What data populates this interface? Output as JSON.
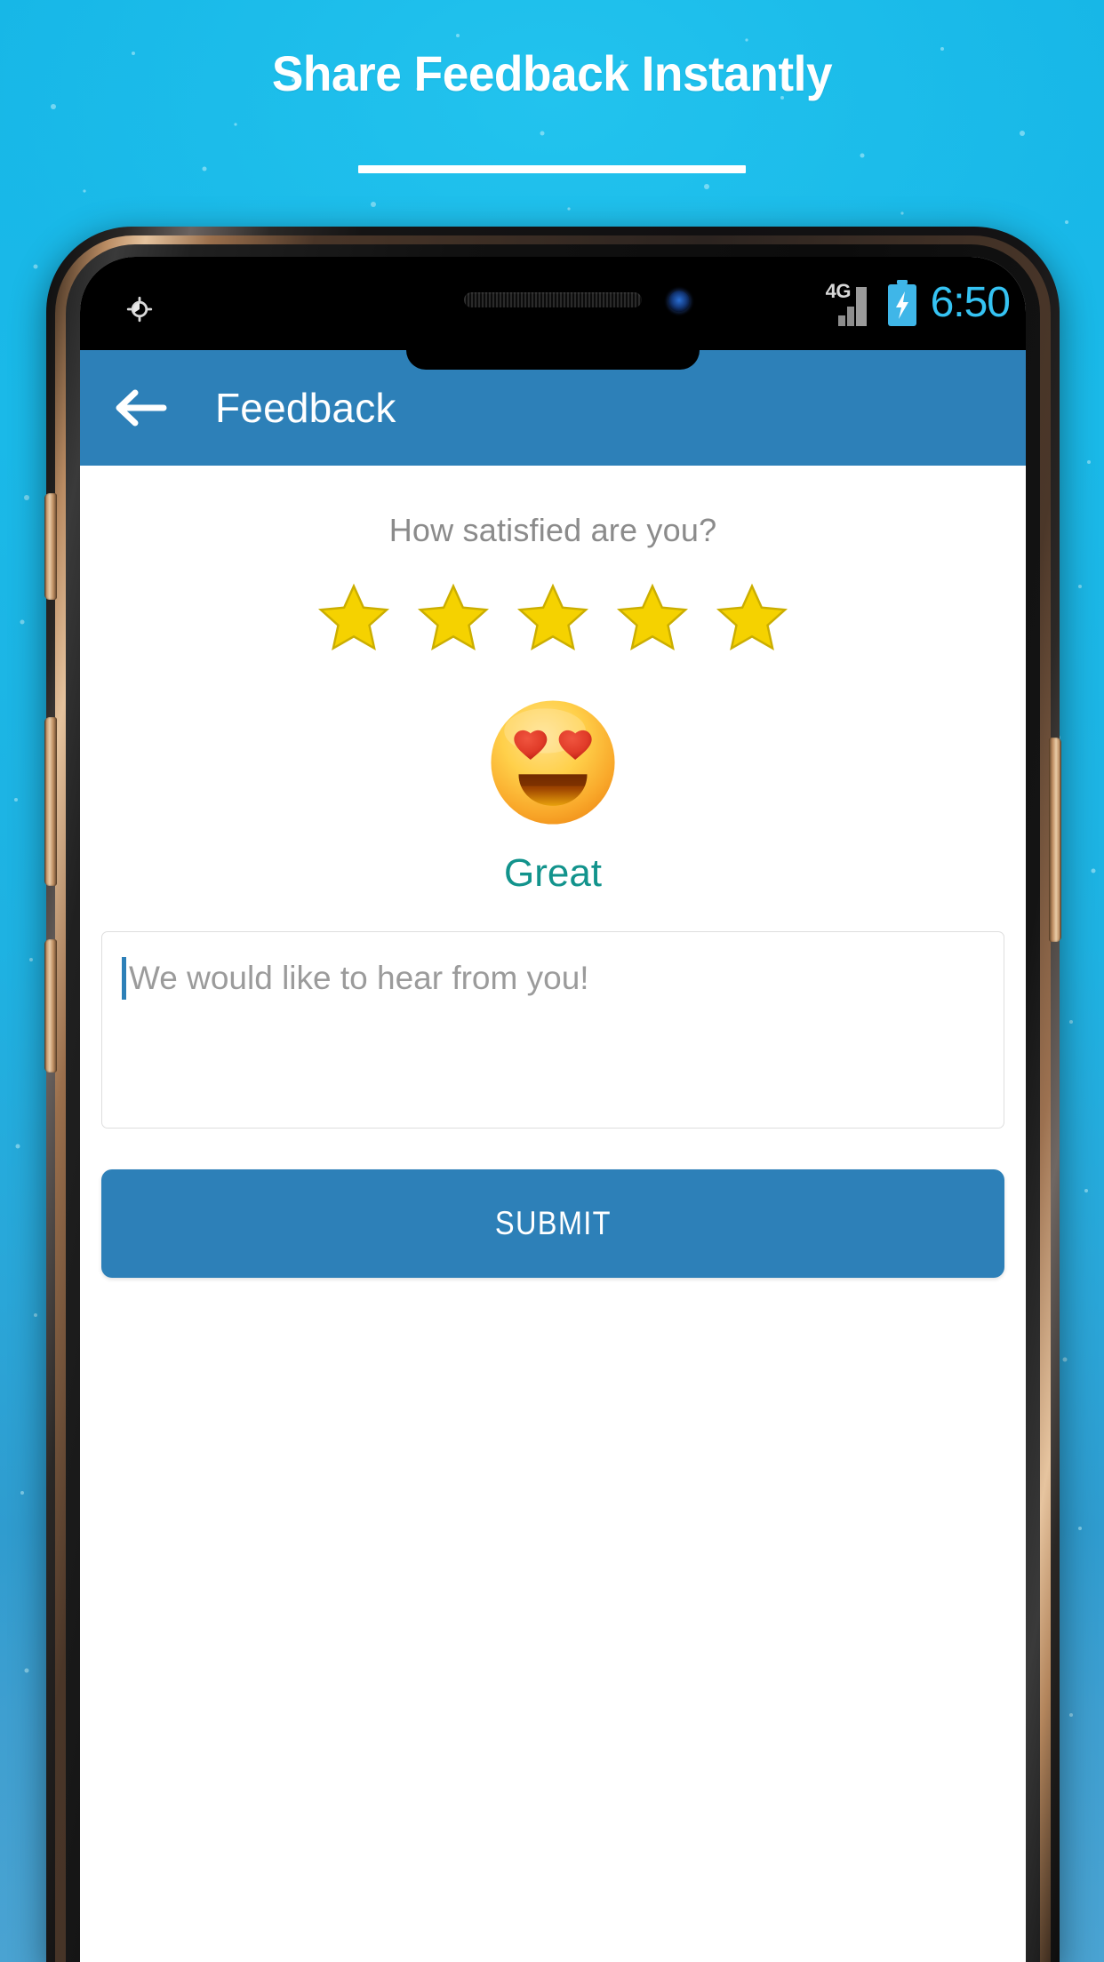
{
  "promo": {
    "headline": "Share Feedback Instantly",
    "accent_color": "#18b9e8",
    "divider_color": "#ffffff"
  },
  "device": {
    "frame_color": "#141414",
    "bevel_color": "#c4966a",
    "buttons": [
      {
        "name": "volume-up",
        "side": "left"
      },
      {
        "name": "volume-down",
        "side": "left"
      },
      {
        "name": "assistant",
        "side": "left"
      },
      {
        "name": "power",
        "side": "right"
      }
    ]
  },
  "statusbar": {
    "gps_icon": "location-icon",
    "network_label": "4G",
    "signal_icon": "signal-bars-icon",
    "battery_icon": "battery-charging-icon",
    "time": "6:50",
    "time_color": "#35c3f3",
    "background": "#000000"
  },
  "appbar": {
    "back_icon": "back-arrow-icon",
    "title": "Feedback",
    "background": "#2d80b8",
    "text_color": "#ffffff"
  },
  "feedback": {
    "question": "How satisfied are you?",
    "question_color": "#8b8b8b",
    "rating": {
      "max": 5,
      "selected": 5,
      "star_icon": "star-icon",
      "star_color": "#f5d200"
    },
    "mood": {
      "emoji_name": "smiling-face-with-heart-eyes-emoji",
      "label": "Great",
      "label_color": "#12938c"
    },
    "comment": {
      "placeholder": "We would like to hear from you!",
      "value": "",
      "border_color": "#dedede",
      "caret_color": "#2d80b8"
    },
    "submit": {
      "label": "SUBMIT",
      "background": "#2d80b8",
      "text_color": "#ffffff"
    }
  }
}
